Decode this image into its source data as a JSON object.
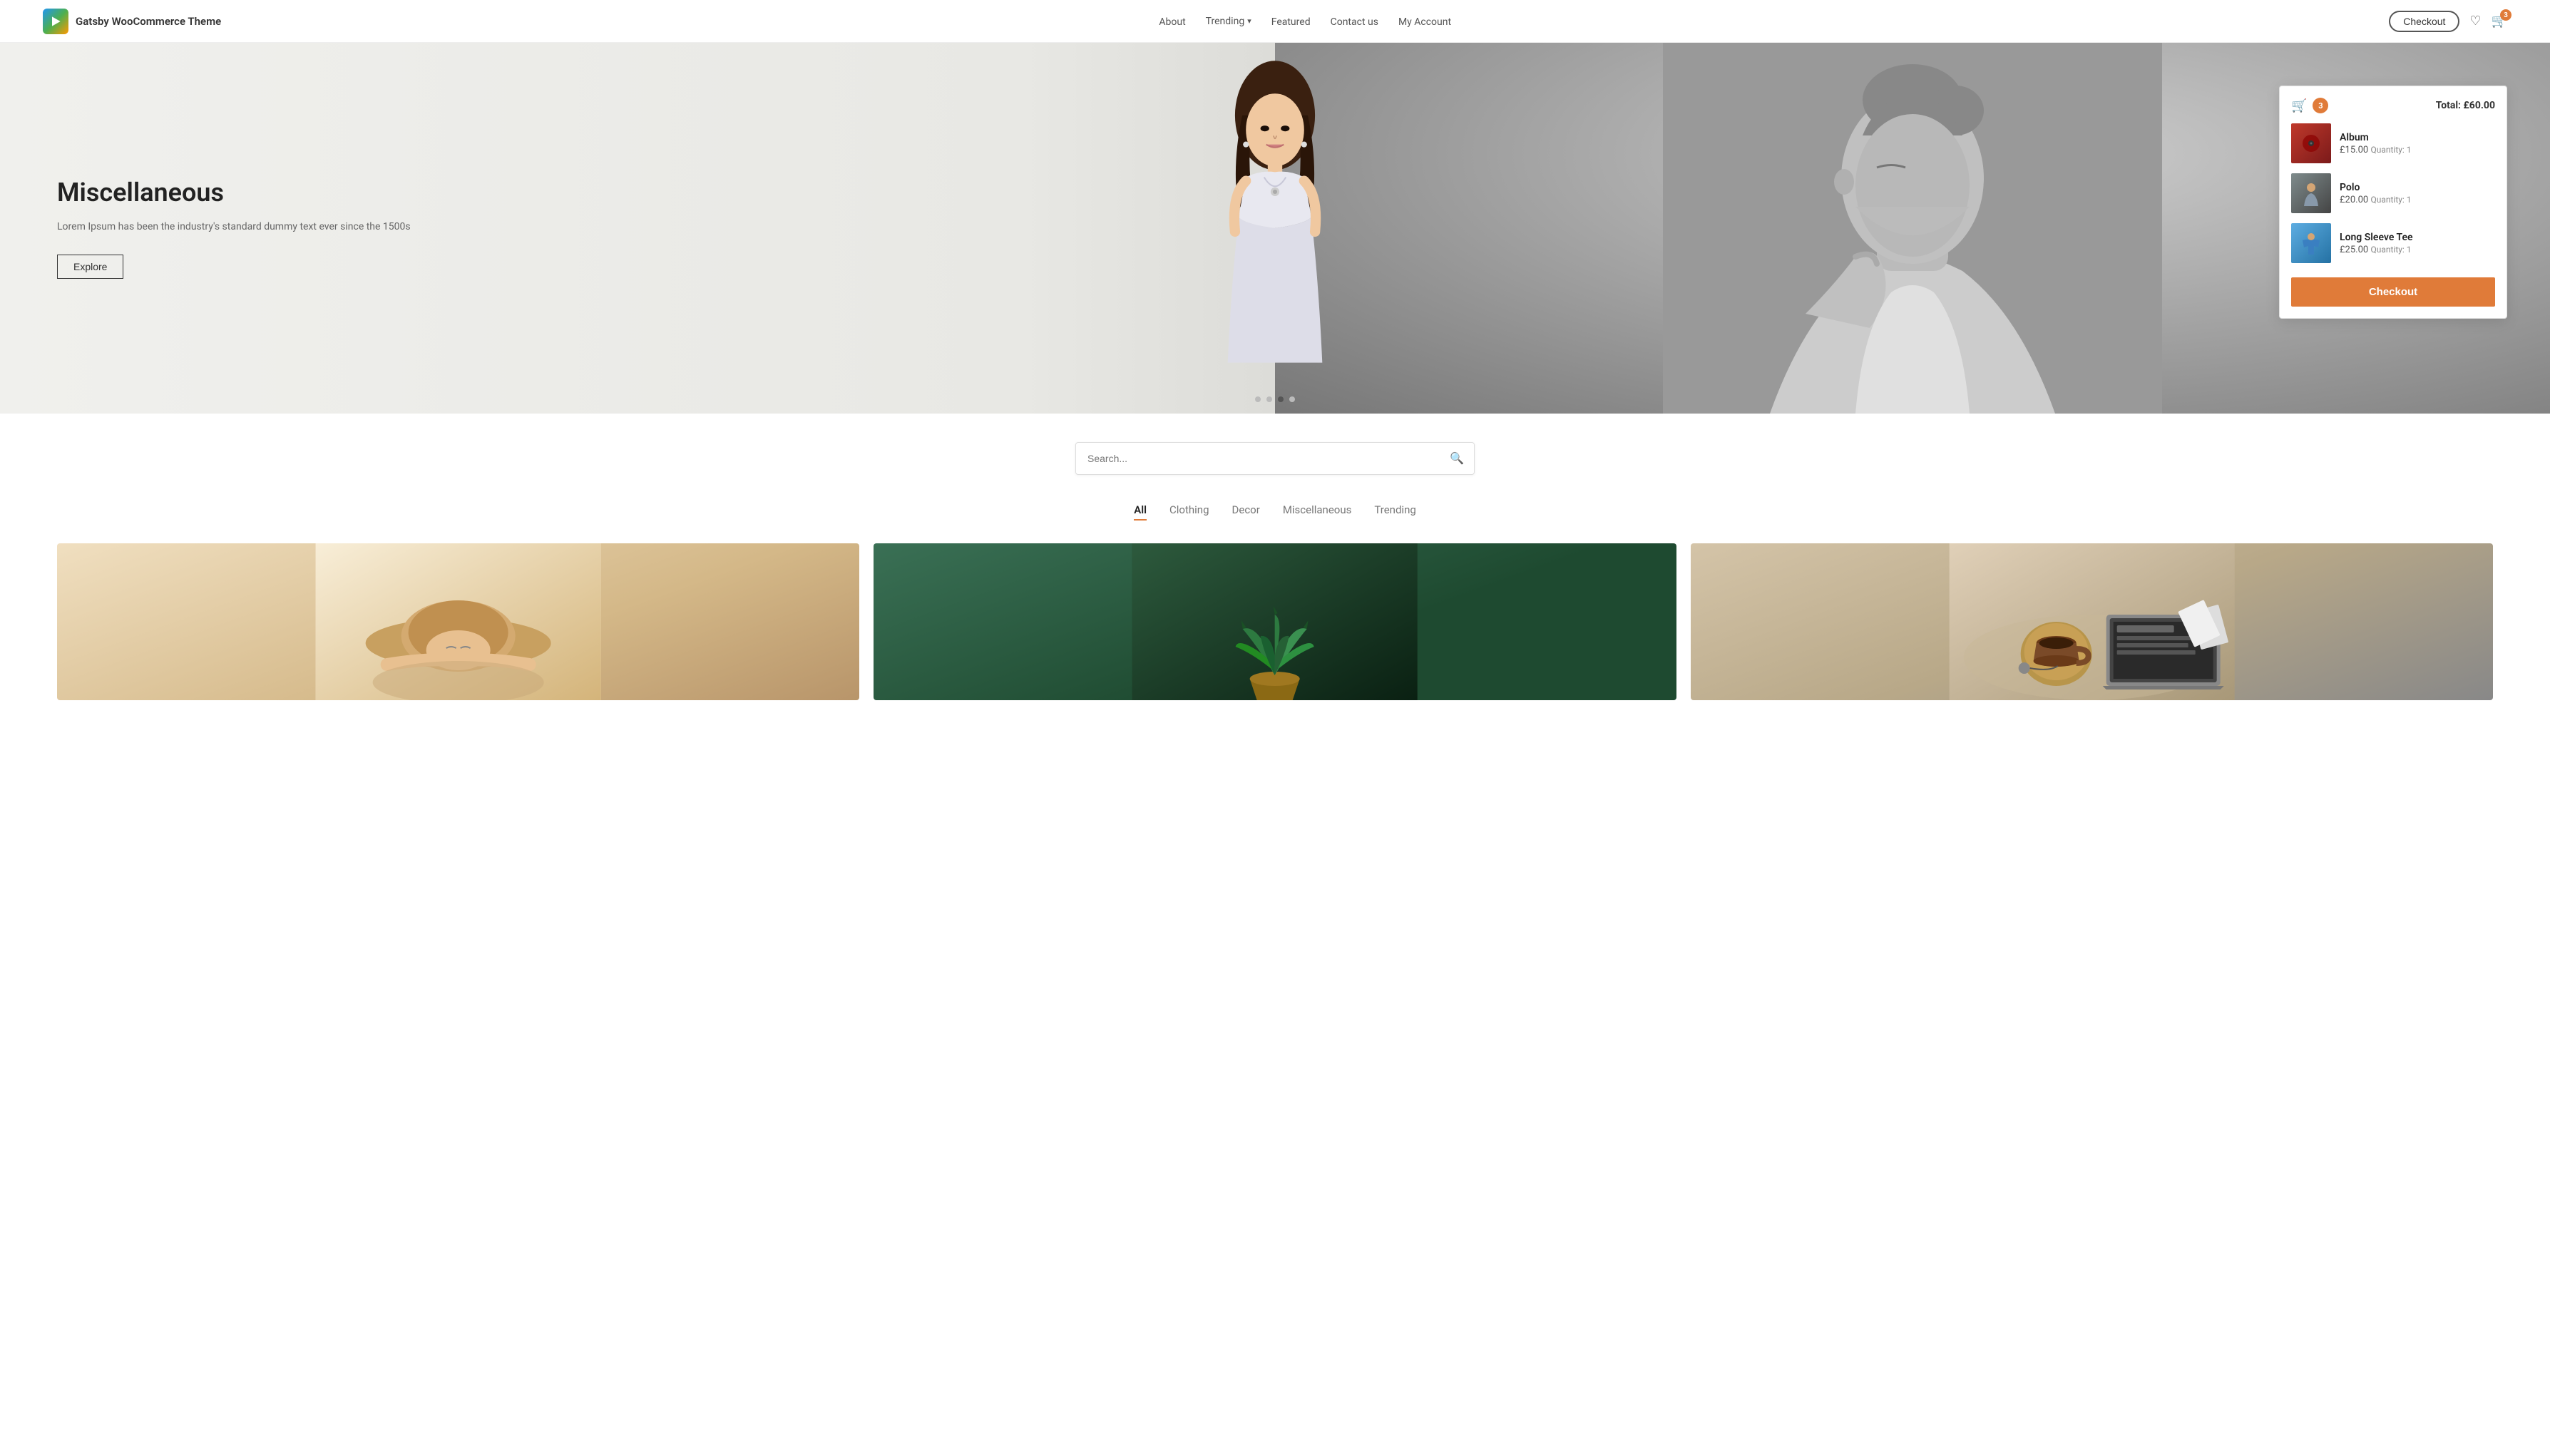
{
  "brand": {
    "name": "Gatsby WooCommerce Theme",
    "logo_alt": "Gatsby Logo"
  },
  "nav": {
    "links": [
      {
        "id": "about",
        "label": "About",
        "has_dropdown": false
      },
      {
        "id": "trending",
        "label": "Trending",
        "has_dropdown": true
      },
      {
        "id": "featured",
        "label": "Featured",
        "has_dropdown": false
      },
      {
        "id": "contact",
        "label": "Contact us",
        "has_dropdown": false
      },
      {
        "id": "myaccount",
        "label": "My Account",
        "has_dropdown": false
      }
    ],
    "checkout_label": "Checkout",
    "cart_count": "3",
    "wishlist_count": ""
  },
  "hero": {
    "title": "Miscellaneous",
    "description": "Lorem Ipsum has been the industry's standard dummy text ever since the 1500s",
    "cta": "Explore",
    "dots": 4,
    "active_dot": 2
  },
  "cart": {
    "icon_count": "3",
    "total_label": "Total:",
    "total_value": "£60.00",
    "items": [
      {
        "id": "album",
        "name": "Album",
        "price": "£15.00",
        "quantity_label": "Quantity: 1",
        "img_class": "img-album"
      },
      {
        "id": "polo",
        "name": "Polo",
        "price": "£20.00",
        "quantity_label": "Quantity: 1",
        "img_class": "img-polo"
      },
      {
        "id": "longsleeve",
        "name": "Long Sleeve Tee",
        "price": "£25.00",
        "quantity_label": "Quantity: 1",
        "img_class": "img-tee"
      }
    ],
    "checkout_label": "Checkout"
  },
  "search": {
    "placeholder": "Search..."
  },
  "filter_tabs": [
    {
      "id": "all",
      "label": "All",
      "active": true
    },
    {
      "id": "clothing",
      "label": "Clothing",
      "active": false
    },
    {
      "id": "decor",
      "label": "Decor",
      "active": false
    },
    {
      "id": "miscellaneous",
      "label": "Miscellaneous",
      "active": false
    },
    {
      "id": "trending",
      "label": "Trending",
      "active": false
    }
  ],
  "products": [
    {
      "id": "p1",
      "img_theme": "hat-woman",
      "alt": "Woman with hat"
    },
    {
      "id": "p2",
      "img_theme": "plant",
      "alt": "Plant"
    },
    {
      "id": "p3",
      "img_theme": "coffee-laptop",
      "alt": "Coffee and laptop"
    }
  ]
}
